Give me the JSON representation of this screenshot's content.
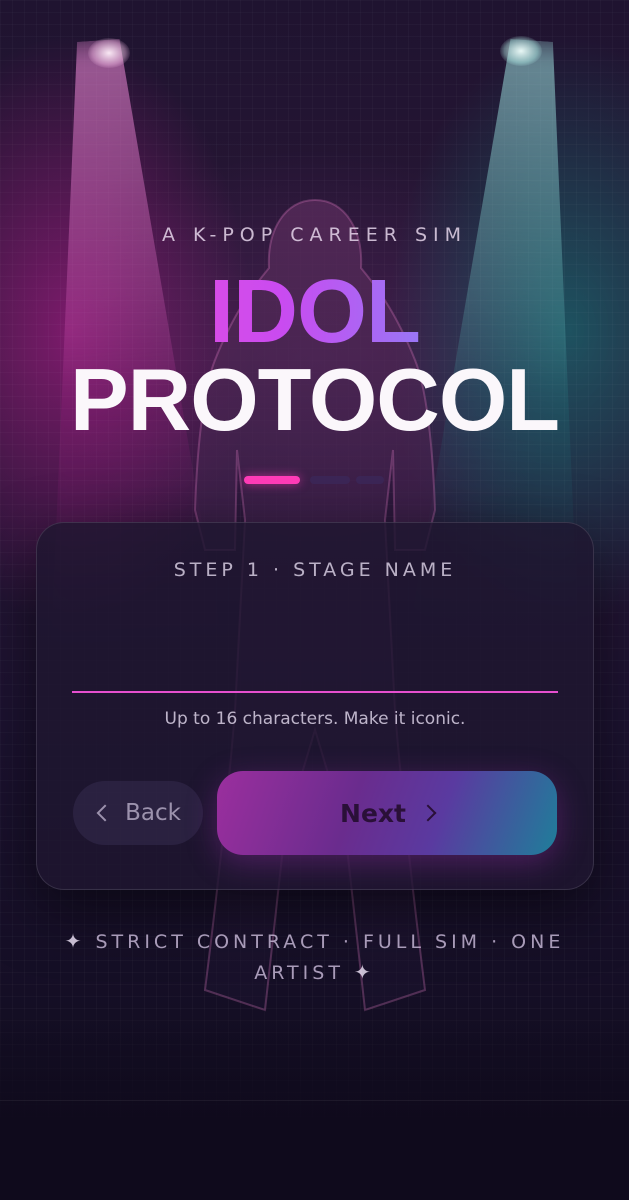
{
  "header": {
    "tagline": "A K-POP CAREER SIM",
    "title_line1": "IDOL",
    "title_line2": "PROTOCOL"
  },
  "progress": {
    "current_step": 1
  },
  "form": {
    "step_label": "STEP 1 · STAGE NAME",
    "stage_name_value": "",
    "hint": "Up to 16 characters. Make it iconic.",
    "back_label": "Back",
    "next_label": "Next"
  },
  "footer": {
    "text": "STRICT CONTRACT · FULL SIM · ONE ARTIST",
    "sparkle": "✦"
  },
  "colors": {
    "accent_pink": "#ff3cb8",
    "title_gradient_start": "#ff4fcf",
    "title_gradient_end": "#4fb8ff",
    "input_underline": "#e64fcf"
  },
  "icons": {
    "back": "chevron-left-icon",
    "next": "chevron-right-icon",
    "footer": "sparkle-icon"
  }
}
